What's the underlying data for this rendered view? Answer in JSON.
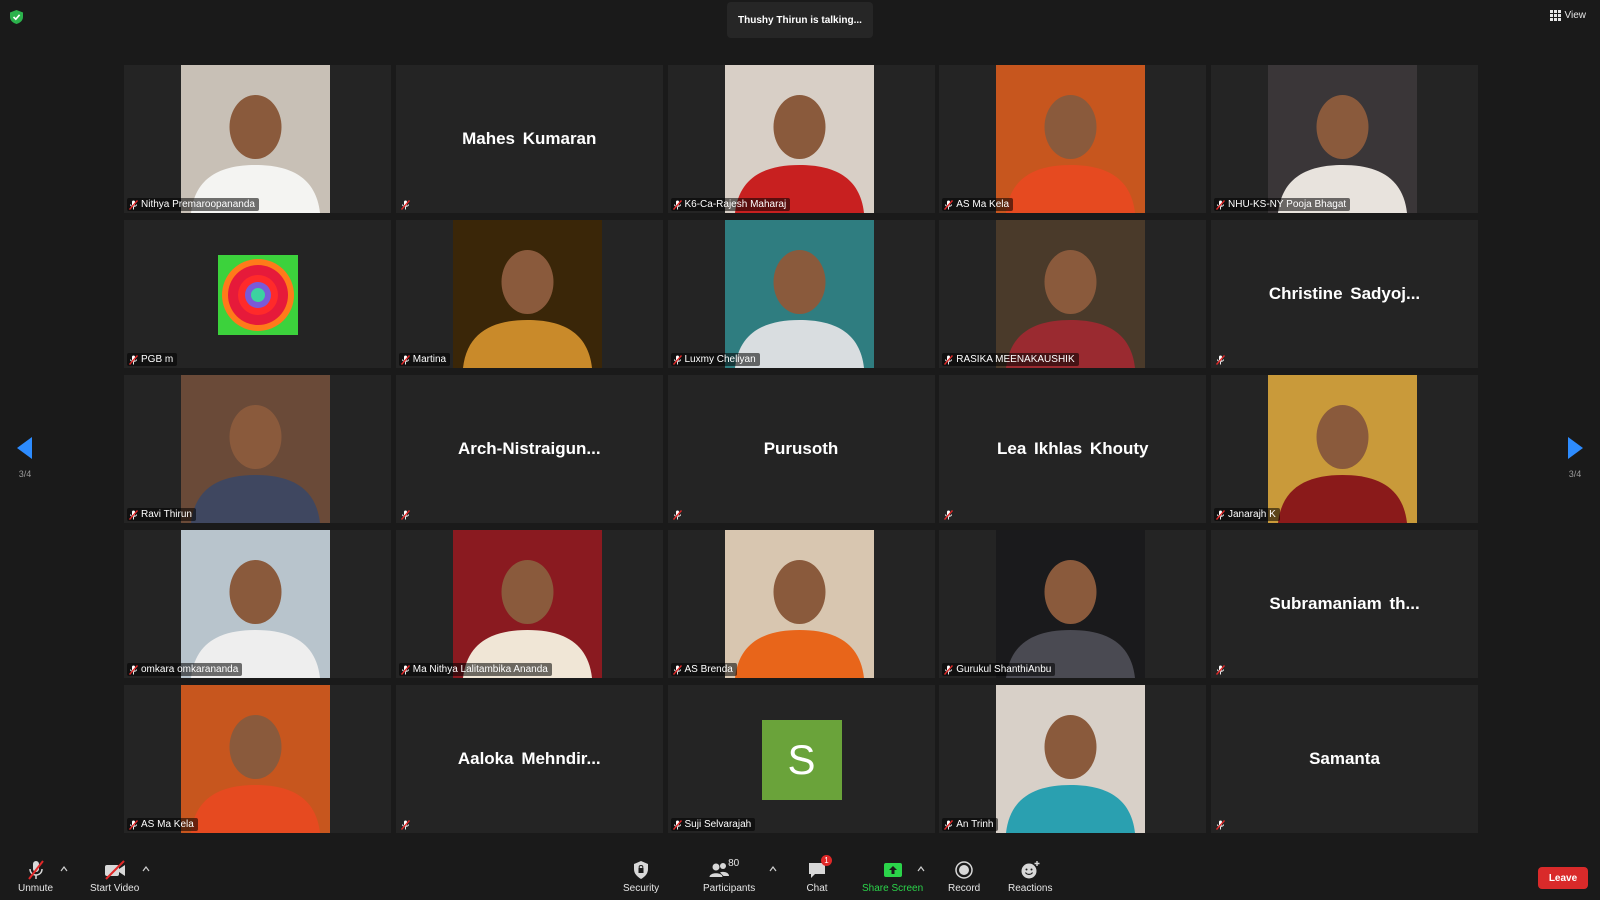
{
  "header": {
    "talking_text": "Thushy Thirun is talking...",
    "view_label": "View"
  },
  "pager": {
    "left_count": "3/4",
    "right_count": "3/4",
    "arrow_color": "#2d8cff"
  },
  "tiles": [
    {
      "label": "Nithya Premaroopananda",
      "display": "",
      "kind": "photo",
      "bg": "#c8c0b6",
      "accent": "#f4f4f2"
    },
    {
      "label": "",
      "display": "Mahes Kumaran",
      "kind": "name"
    },
    {
      "label": "K6-Ca-Rajesh Maharaj",
      "display": "",
      "kind": "photo",
      "bg": "#d8cfc6",
      "accent": "#c82020"
    },
    {
      "label": "AS Ma Kela",
      "display": "",
      "kind": "photo",
      "bg": "#c7561e",
      "accent": "#e64a20"
    },
    {
      "label": "NHU-KS-NY Pooja Bhagat",
      "display": "",
      "kind": "photo",
      "bg": "#3a3638",
      "accent": "#e8e3dd"
    },
    {
      "label": "PGB m",
      "display": "",
      "kind": "mandala"
    },
    {
      "label": "Martina",
      "display": "",
      "kind": "photo",
      "bg": "#3a2608",
      "accent": "#c98a2a"
    },
    {
      "label": "Luxmy Cheliyan",
      "display": "",
      "kind": "photo",
      "bg": "#2f7d80",
      "accent": "#d9dde0"
    },
    {
      "label": "RASIKA MEENAKAUSHIK",
      "display": "",
      "kind": "photo",
      "bg": "#4a3a2a",
      "accent": "#9a2a30"
    },
    {
      "label": "",
      "display": "Christine  Sadyoj...",
      "kind": "name"
    },
    {
      "label": "Ravi Thirun",
      "display": "",
      "kind": "photo",
      "bg": "#6a4a38",
      "accent": "#3f4760"
    },
    {
      "label": "",
      "display": "Arch-Nistraigun...",
      "kind": "name"
    },
    {
      "label": "",
      "display": "Purusoth",
      "kind": "name"
    },
    {
      "label": "",
      "display": "Lea Ikhlas Khouty",
      "kind": "name"
    },
    {
      "label": "Janarajh K",
      "display": "",
      "kind": "photo",
      "bg": "#c99a3a",
      "accent": "#8a1a1a"
    },
    {
      "label": "omkara omkarananda",
      "display": "",
      "kind": "photo",
      "bg": "#b8c4cc",
      "accent": "#eeeeee"
    },
    {
      "label": "Ma Nithya Lalitambika Ananda",
      "display": "",
      "kind": "photo",
      "bg": "#8a1a20",
      "accent": "#f0e6d6"
    },
    {
      "label": "AS Brenda",
      "display": "",
      "kind": "photo",
      "bg": "#d8c6b0",
      "accent": "#e8651a"
    },
    {
      "label": "Gurukul ShanthiAnbu",
      "display": "",
      "kind": "photo",
      "bg": "#1a1a1c",
      "accent": "#4a4a52"
    },
    {
      "label": "",
      "display": "Subramaniam  th...",
      "kind": "name"
    },
    {
      "label": "AS Ma Kela",
      "display": "",
      "kind": "photo",
      "bg": "#c7561e",
      "accent": "#e64a20"
    },
    {
      "label": "",
      "display": "Aaloka  Mehndir...",
      "kind": "name"
    },
    {
      "label": "Suji Selvarajah",
      "display": "",
      "kind": "avatar",
      "letter": "S"
    },
    {
      "label": "An Trinh",
      "display": "",
      "kind": "photo",
      "bg": "#d8d0c8",
      "accent": "#2aa0b0"
    },
    {
      "label": "",
      "display": "Samanta",
      "kind": "name"
    }
  ],
  "toolbar": {
    "unmute": "Unmute",
    "start_video": "Start Video",
    "security": "Security",
    "participants": "Participants",
    "participants_count": "80",
    "chat": "Chat",
    "chat_badge": "1",
    "share_screen": "Share Screen",
    "record": "Record",
    "reactions": "Reactions",
    "leave": "Leave"
  },
  "colors": {
    "background": "#1a1a1a",
    "tile": "#242424",
    "leave": "#d92a2a",
    "share_green": "#2bd44a",
    "muted_red": "#e02828"
  }
}
